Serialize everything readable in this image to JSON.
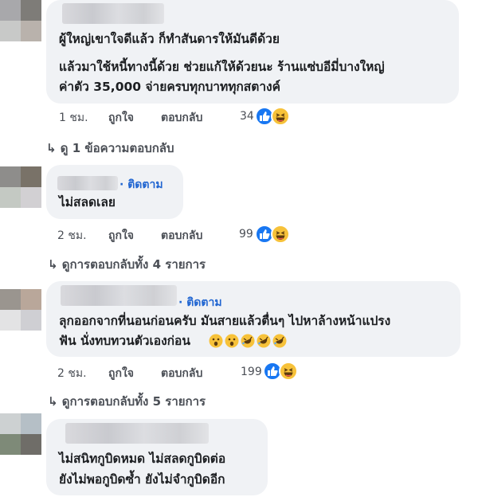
{
  "comments": [
    {
      "follow_label": "",
      "lines": [
        "ผู้ใหญ่เขาใจดีแล้ว ก็ทำสันดารให้มันดีด้วย",
        "แล้วมาใช้หนี้ทางนี้ด้วย ช่วยแก้ให้ด้วยนะ ร้านแซ่บอีมี่บางใหญ่",
        "ค่าตัว 35,000 จ่ายครบทุกบาททุกสตางค์"
      ],
      "time": "1 ชม.",
      "like": "ถูกใจ",
      "reply": "ตอบกลับ",
      "reaction_count": "34",
      "replies_link": "ดู 1 ข้อความตอบกลับ"
    },
    {
      "follow_label": "· ติดตาม",
      "lines": [
        "ไม่สลดเลย"
      ],
      "time": "2 ชม.",
      "like": "ถูกใจ",
      "reply": "ตอบกลับ",
      "reaction_count": "99",
      "replies_link": "ดูการตอบกลับทั้ง 4 รายการ"
    },
    {
      "follow_label": "· ติดตาม",
      "lines": [
        "ลุกออกจากที่นอนก่อนครับ มันสายแล้วตื่นๆ ไปหาล้างหน้าแปรง",
        "ฟัน นั่งทบทวนตัวเองก่อน"
      ],
      "emojis": [
        "open-mouth-emoji",
        "open-mouth-emoji",
        "rofl-emoji",
        "rofl-emoji",
        "rofl-emoji"
      ],
      "time": "2 ชม.",
      "like": "ถูกใจ",
      "reply": "ตอบกลับ",
      "reaction_count": "199",
      "replies_link": "ดูการตอบกลับทั้ง 5 รายการ"
    },
    {
      "follow_label": "",
      "lines": [
        "ไม่สนิทกูบิดหมด ไม่สลดกูบิดต่อ",
        "ยังไม่พอกูบิดซ้ำ ยังไม่จำกูบิดอีก"
      ]
    }
  ],
  "colors": {
    "bubble": "#f0f2f5",
    "follow": "#2065d1",
    "like_reaction": "#1877f2",
    "haha_reaction": "#f7c23a"
  }
}
